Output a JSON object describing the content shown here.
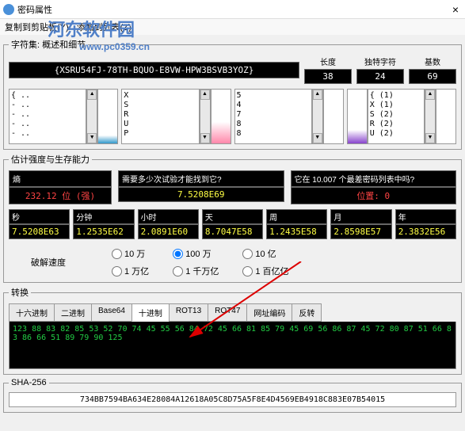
{
  "window": {
    "title": "密码属性",
    "close": "×"
  },
  "menu": {
    "copy": "复制到剪贴板(Y)",
    "add": "添加到列表(Z)"
  },
  "watermark": {
    "main": "河东软件园",
    "url": "www.pc0359.cn"
  },
  "charset": {
    "legend": "字符集: 概述和细节",
    "password": "{XSRU54FJ-78TH-BQUO-E8VW-HPW3BSVB3YOZ}",
    "stats": [
      {
        "label": "长度",
        "value": "38"
      },
      {
        "label": "独特字符",
        "value": "24"
      },
      {
        "label": "基数",
        "value": "69"
      }
    ],
    "lists": [
      "{ ..\n- ..\n- ..\n- ..\n- ..",
      "X\nS\nR\nU\nP",
      "5\n4\n7\n8\n8",
      "{ (1)\nX (1)\nS (2)\nR (2)\nU (2)"
    ]
  },
  "strength": {
    "legend": "估计强度与生存能力",
    "entropy_label": "熵",
    "entropy_value": "232.12 位 (强)",
    "attempts_label": "需要多少次试验才能找到它?",
    "attempts_value": "7.5208E69",
    "worst_label": "它在 10.007 个最差密码列表中吗?",
    "worst_value": "位置: 0",
    "times": [
      {
        "label": "秒",
        "value": "7.5208E63"
      },
      {
        "label": "分钟",
        "value": "1.2535E62"
      },
      {
        "label": "小时",
        "value": "2.0891E60"
      },
      {
        "label": "天",
        "value": "8.7047E58"
      },
      {
        "label": "周",
        "value": "1.2435E58"
      },
      {
        "label": "月",
        "value": "2.8598E57"
      },
      {
        "label": "年",
        "value": "2.3832E56"
      }
    ],
    "speed_label": "破解速度",
    "radios": [
      {
        "label": "10 万",
        "checked": false
      },
      {
        "label": "1 万亿",
        "checked": false
      },
      {
        "label": "100 万",
        "checked": true
      },
      {
        "label": "1 千万亿",
        "checked": false
      },
      {
        "label": "10 亿",
        "checked": false
      },
      {
        "label": "1 百亿亿",
        "checked": false
      }
    ]
  },
  "conversion": {
    "legend": "转换",
    "tabs": [
      "十六进制",
      "二进制",
      "Base64",
      "十进制",
      "ROT13",
      "ROT47",
      "网址编码",
      "反转"
    ],
    "active_tab": 3,
    "data": "123 88 83 82 85 53 52 70 74 45 55 56 84 72 45 66 81 85 79 45 69 56 86 87 45 72 80 87 51 66 83 86 66 51 89 79 90 125"
  },
  "sha": {
    "legend": "SHA-256",
    "value": "734BB7594BA634E28084A12618A05C8D75A5F8E4D4569EB4918C883E07B54015"
  }
}
